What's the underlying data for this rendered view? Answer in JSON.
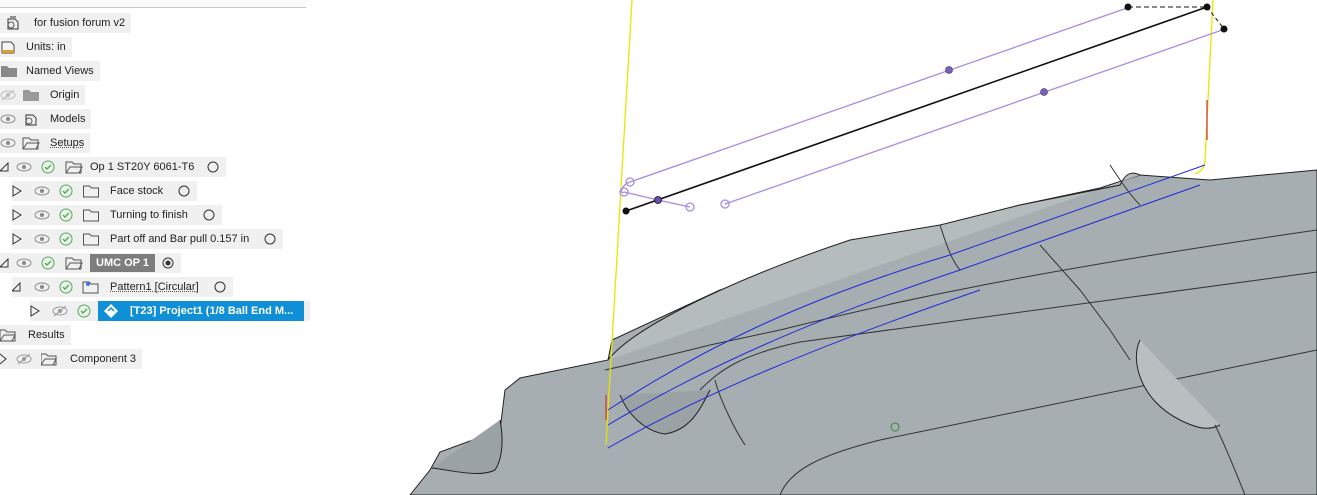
{
  "browser": {
    "doc_name": "for fusion forum v2",
    "items": [
      {
        "label": "Units: in"
      },
      {
        "label": "Named Views"
      },
      {
        "label": "Origin"
      },
      {
        "label": "Models"
      },
      {
        "label": "Setups"
      },
      {
        "label": "Op 1 ST20Y 6061-T6"
      },
      {
        "label": "Face stock"
      },
      {
        "label": "Turning to finish"
      },
      {
        "label": "Part off and Bar pull 0.157 in"
      },
      {
        "label": "UMC OP 1"
      },
      {
        "label": "Pattern1 [Circular]"
      },
      {
        "label": "[T23] Project1 (1/8  Ball End M..."
      },
      {
        "label": "Results"
      },
      {
        "label": "Component 3"
      }
    ]
  },
  "colors": {
    "selection": "#0f8fd6",
    "row_bg": "#f0f0f0",
    "ok_check": "#4caf50",
    "toolpath_purple": "#a98be8",
    "path_blue": "#1f2bd8",
    "axis_yellow": "#e6e600",
    "model_gray": "#a8b0b3"
  }
}
